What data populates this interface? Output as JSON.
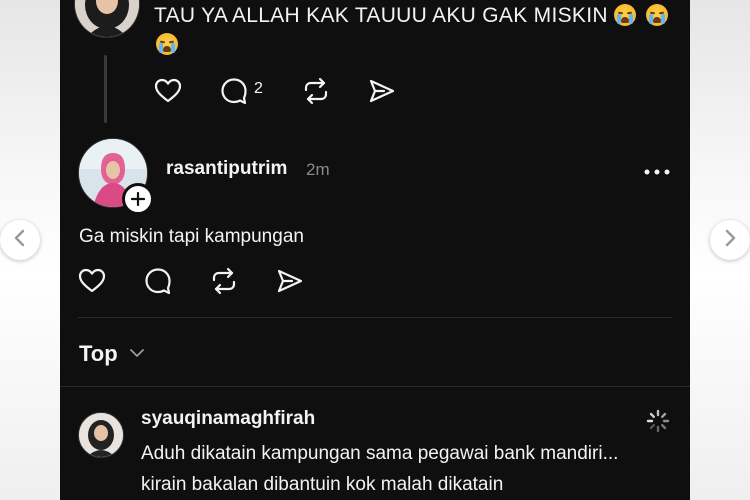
{
  "colors": {
    "panel_bg": "#0f0f10",
    "text": "#f3f3f3",
    "muted": "#8a8a8a",
    "page_bg": "#ececec"
  },
  "post_previous": {
    "text_line1": "TAU YA ALLAH KAK TAUUU AKU GAK MISKIN",
    "reply_count": "2",
    "actions": [
      "heart-icon",
      "comment-icon",
      "repost-icon",
      "send-icon"
    ]
  },
  "reply_post": {
    "username": "rasantiputrim",
    "time": "2m",
    "text": "Ga miskin tapi kampungan",
    "actions": [
      "heart-icon",
      "comment-icon",
      "repost-icon",
      "send-icon"
    ]
  },
  "sort": {
    "label": "Top"
  },
  "comment": {
    "username": "syauqinamaghfirah",
    "line1": "Aduh dikatain kampungan sama pegawai bank mandiri...",
    "line2": "kirain bakalan dibantuin kok malah dikatain"
  }
}
